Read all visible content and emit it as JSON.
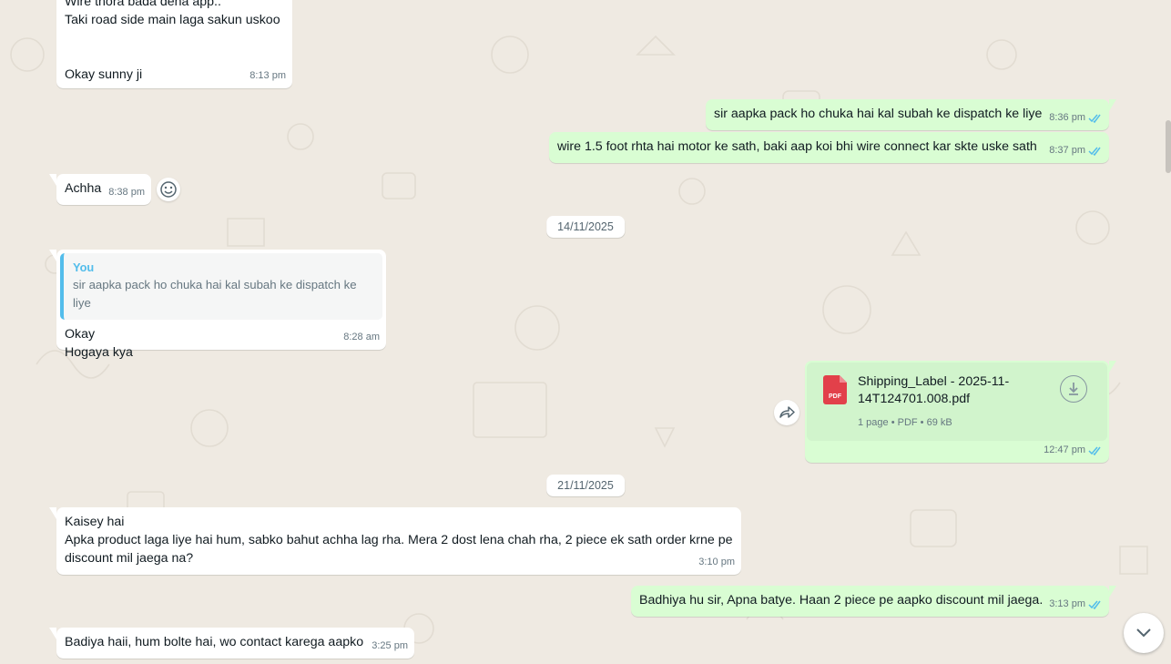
{
  "colors": {
    "incoming": "#ffffff",
    "outgoing": "#d9fdd3",
    "background": "#efeae2",
    "read_tick": "#53bdeb",
    "pdf_red": "#e2404a"
  },
  "messages": {
    "m1": {
      "text": "Wire thora bada dena app..\nTaki road side main laga sakun uskoo\n\n\nOkay sunny ji",
      "time": "8:13 pm"
    },
    "m2": {
      "text": "sir aapka pack ho chuka hai kal subah ke dispatch ke liye",
      "time": "8:36 pm"
    },
    "m3": {
      "text": "wire 1.5 foot rhta hai motor ke sath, baki aap koi bhi wire connect kar skte uske sath",
      "time": "8:37 pm"
    },
    "m4": {
      "text": "Achha",
      "time": "8:38 pm"
    },
    "m5": {
      "reply_author": "You",
      "reply_text": "sir aapka pack ho chuka hai kal subah ke dispatch ke liye",
      "text": "Okay\nHogaya kya",
      "time": "8:28 am"
    },
    "m6": {
      "file_name": "Shipping_Label - 2025-11-14T124701.008.pdf",
      "file_info": "1 page • PDF • 69 kB",
      "pdf_badge": "PDF",
      "time": "12:47 pm"
    },
    "m7": {
      "text": "Kaisey hai\nApka product laga liye hai hum, sabko bahut achha lag rha. Mera 2 dost lena chah rha, 2 piece ek sath order krne pe discount mil jaega na?",
      "time": "3:10 pm"
    },
    "m8": {
      "text": "Badhiya hu sir, Apna batye. Haan 2 piece pe aapko discount mil jaega.",
      "time": "3:13 pm"
    },
    "m9": {
      "text": "Badiya haii, hum bolte hai, wo contact karega aapko",
      "time": "3:25 pm"
    }
  },
  "dates": {
    "d1": "14/11/2025",
    "d2": "21/11/2025"
  },
  "icons": {
    "tick": "double-check-icon",
    "emoji": "emoji-reaction-icon",
    "forward": "forward-icon",
    "download": "download-icon",
    "scroll": "chevron-down-icon"
  }
}
